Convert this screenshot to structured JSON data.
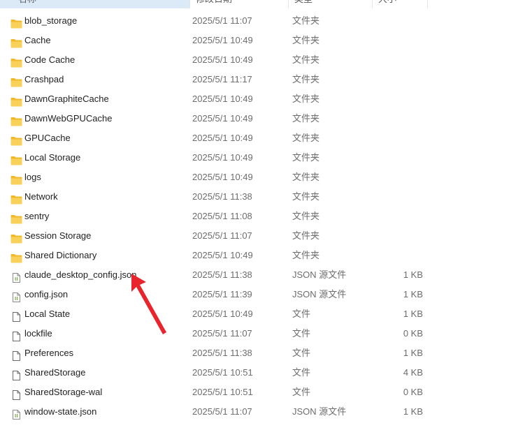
{
  "header": {
    "name": "名称",
    "date": "修改日期",
    "type": "类型",
    "size": "大小"
  },
  "colors": {
    "header_selected_bg": "#dce9f7",
    "folder": "#f5c542",
    "arrow": "#e8242c"
  },
  "files": [
    {
      "name": "blob_storage",
      "date": "2025/5/1 11:07",
      "type": "文件夹",
      "size": "",
      "icon": "folder-icon"
    },
    {
      "name": "Cache",
      "date": "2025/5/1 10:49",
      "type": "文件夹",
      "size": "",
      "icon": "folder-icon"
    },
    {
      "name": "Code Cache",
      "date": "2025/5/1 10:49",
      "type": "文件夹",
      "size": "",
      "icon": "folder-icon"
    },
    {
      "name": "Crashpad",
      "date": "2025/5/1 11:17",
      "type": "文件夹",
      "size": "",
      "icon": "folder-icon"
    },
    {
      "name": "DawnGraphiteCache",
      "date": "2025/5/1 10:49",
      "type": "文件夹",
      "size": "",
      "icon": "folder-icon"
    },
    {
      "name": "DawnWebGPUCache",
      "date": "2025/5/1 10:49",
      "type": "文件夹",
      "size": "",
      "icon": "folder-icon"
    },
    {
      "name": "GPUCache",
      "date": "2025/5/1 10:49",
      "type": "文件夹",
      "size": "",
      "icon": "folder-icon"
    },
    {
      "name": "Local Storage",
      "date": "2025/5/1 10:49",
      "type": "文件夹",
      "size": "",
      "icon": "folder-icon"
    },
    {
      "name": "logs",
      "date": "2025/5/1 10:49",
      "type": "文件夹",
      "size": "",
      "icon": "folder-icon"
    },
    {
      "name": "Network",
      "date": "2025/5/1 11:38",
      "type": "文件夹",
      "size": "",
      "icon": "folder-icon"
    },
    {
      "name": "sentry",
      "date": "2025/5/1 11:08",
      "type": "文件夹",
      "size": "",
      "icon": "folder-icon"
    },
    {
      "name": "Session Storage",
      "date": "2025/5/1 11:07",
      "type": "文件夹",
      "size": "",
      "icon": "folder-icon"
    },
    {
      "name": "Shared Dictionary",
      "date": "2025/5/1 10:49",
      "type": "文件夹",
      "size": "",
      "icon": "folder-icon"
    },
    {
      "name": "claude_desktop_config.json",
      "date": "2025/5/1 11:38",
      "type": "JSON 源文件",
      "size": "1 KB",
      "icon": "json-file-icon"
    },
    {
      "name": "config.json",
      "date": "2025/5/1 11:39",
      "type": "JSON 源文件",
      "size": "1 KB",
      "icon": "json-file-icon"
    },
    {
      "name": "Local State",
      "date": "2025/5/1 10:49",
      "type": "文件",
      "size": "1 KB",
      "icon": "file-icon"
    },
    {
      "name": "lockfile",
      "date": "2025/5/1 11:07",
      "type": "文件",
      "size": "0 KB",
      "icon": "file-icon"
    },
    {
      "name": "Preferences",
      "date": "2025/5/1 11:38",
      "type": "文件",
      "size": "1 KB",
      "icon": "file-icon"
    },
    {
      "name": "SharedStorage",
      "date": "2025/5/1 10:51",
      "type": "文件",
      "size": "4 KB",
      "icon": "file-icon"
    },
    {
      "name": "SharedStorage-wal",
      "date": "2025/5/1 10:51",
      "type": "文件",
      "size": "0 KB",
      "icon": "file-icon"
    },
    {
      "name": "window-state.json",
      "date": "2025/5/1 11:07",
      "type": "JSON 源文件",
      "size": "1 KB",
      "icon": "json-file-icon"
    }
  ]
}
